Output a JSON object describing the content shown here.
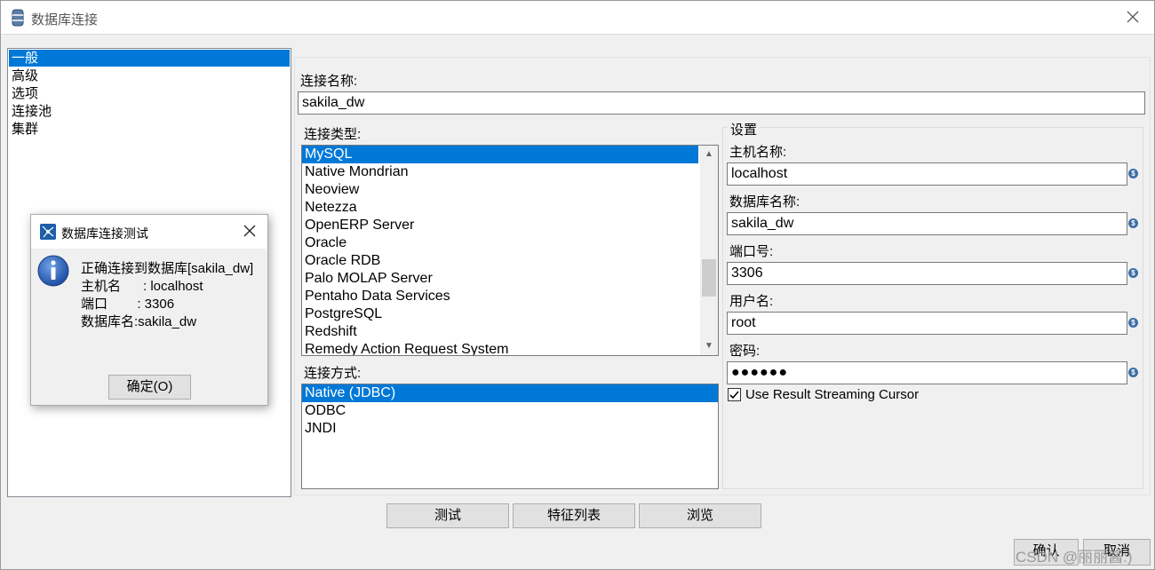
{
  "window": {
    "title": "数据库连接"
  },
  "nav": {
    "items": [
      "一般",
      "高级",
      "选项",
      "连接池",
      "集群"
    ],
    "selected_index": 0
  },
  "connection_name": {
    "label": "连接名称:",
    "value": "sakila_dw"
  },
  "connection_type": {
    "label": "连接类型:",
    "items": [
      "MySQL",
      "Native Mondrian",
      "Neoview",
      "Netezza",
      "OpenERP Server",
      "Oracle",
      "Oracle RDB",
      "Palo MOLAP Server",
      "Pentaho Data Services",
      "PostgreSQL",
      "Redshift",
      "Remedy Action Request System"
    ],
    "selected": "MySQL"
  },
  "access": {
    "label": "连接方式:",
    "items": [
      "Native (JDBC)",
      "ODBC",
      "JNDI"
    ],
    "selected": "Native (JDBC)"
  },
  "settings": {
    "title": "设置",
    "host_label": "主机名称:",
    "host_value": "localhost",
    "db_label": "数据库名称:",
    "db_value": "sakila_dw",
    "port_label": "端口号:",
    "port_value": "3306",
    "user_label": "用户名:",
    "user_value": "root",
    "password_label": "密码:",
    "password_value": "●●●●●●",
    "streaming_label": "Use Result Streaming Cursor",
    "streaming_checked": true
  },
  "buttons": {
    "test": "测试",
    "features": "特征列表",
    "browse": "浏览",
    "ok": "确认",
    "cancel": "取消"
  },
  "dialog": {
    "title": "数据库连接测试",
    "lines": [
      "正确连接到数据库[sakila_dw]",
      "主机名      : localhost",
      "端口        : 3306",
      "数据库名:sakila_dw"
    ],
    "ok_label": "确定(O)"
  },
  "watermark": "CSDN @丽丽酱:)",
  "colors": {
    "selection": "#0078d7",
    "dialog_icon": "#1f5fa8"
  }
}
